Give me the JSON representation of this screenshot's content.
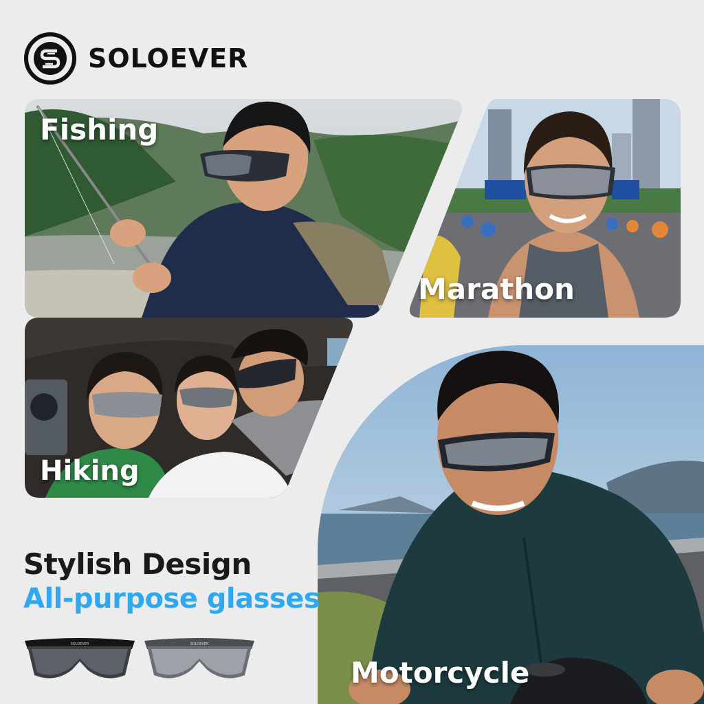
{
  "brand": {
    "name": "SOLOEVER",
    "logo_icon": "s-monogram-icon",
    "lens_print": "SOLOEVER"
  },
  "panels": [
    {
      "id": "fishing",
      "label": "Fishing"
    },
    {
      "id": "marathon",
      "label": "Marathon"
    },
    {
      "id": "hiking",
      "label": "Hiking"
    },
    {
      "id": "motorcycle",
      "label": "Motorcycle"
    }
  ],
  "tagline": {
    "headline": "Stylish Design",
    "subline": "All-purpose glasses"
  },
  "colors": {
    "accent": "#2fa8f0",
    "text_dark": "#1a1a1a",
    "background": "#ececec"
  },
  "products": [
    {
      "name": "black-frame-glasses"
    },
    {
      "name": "grey-frame-glasses"
    }
  ]
}
